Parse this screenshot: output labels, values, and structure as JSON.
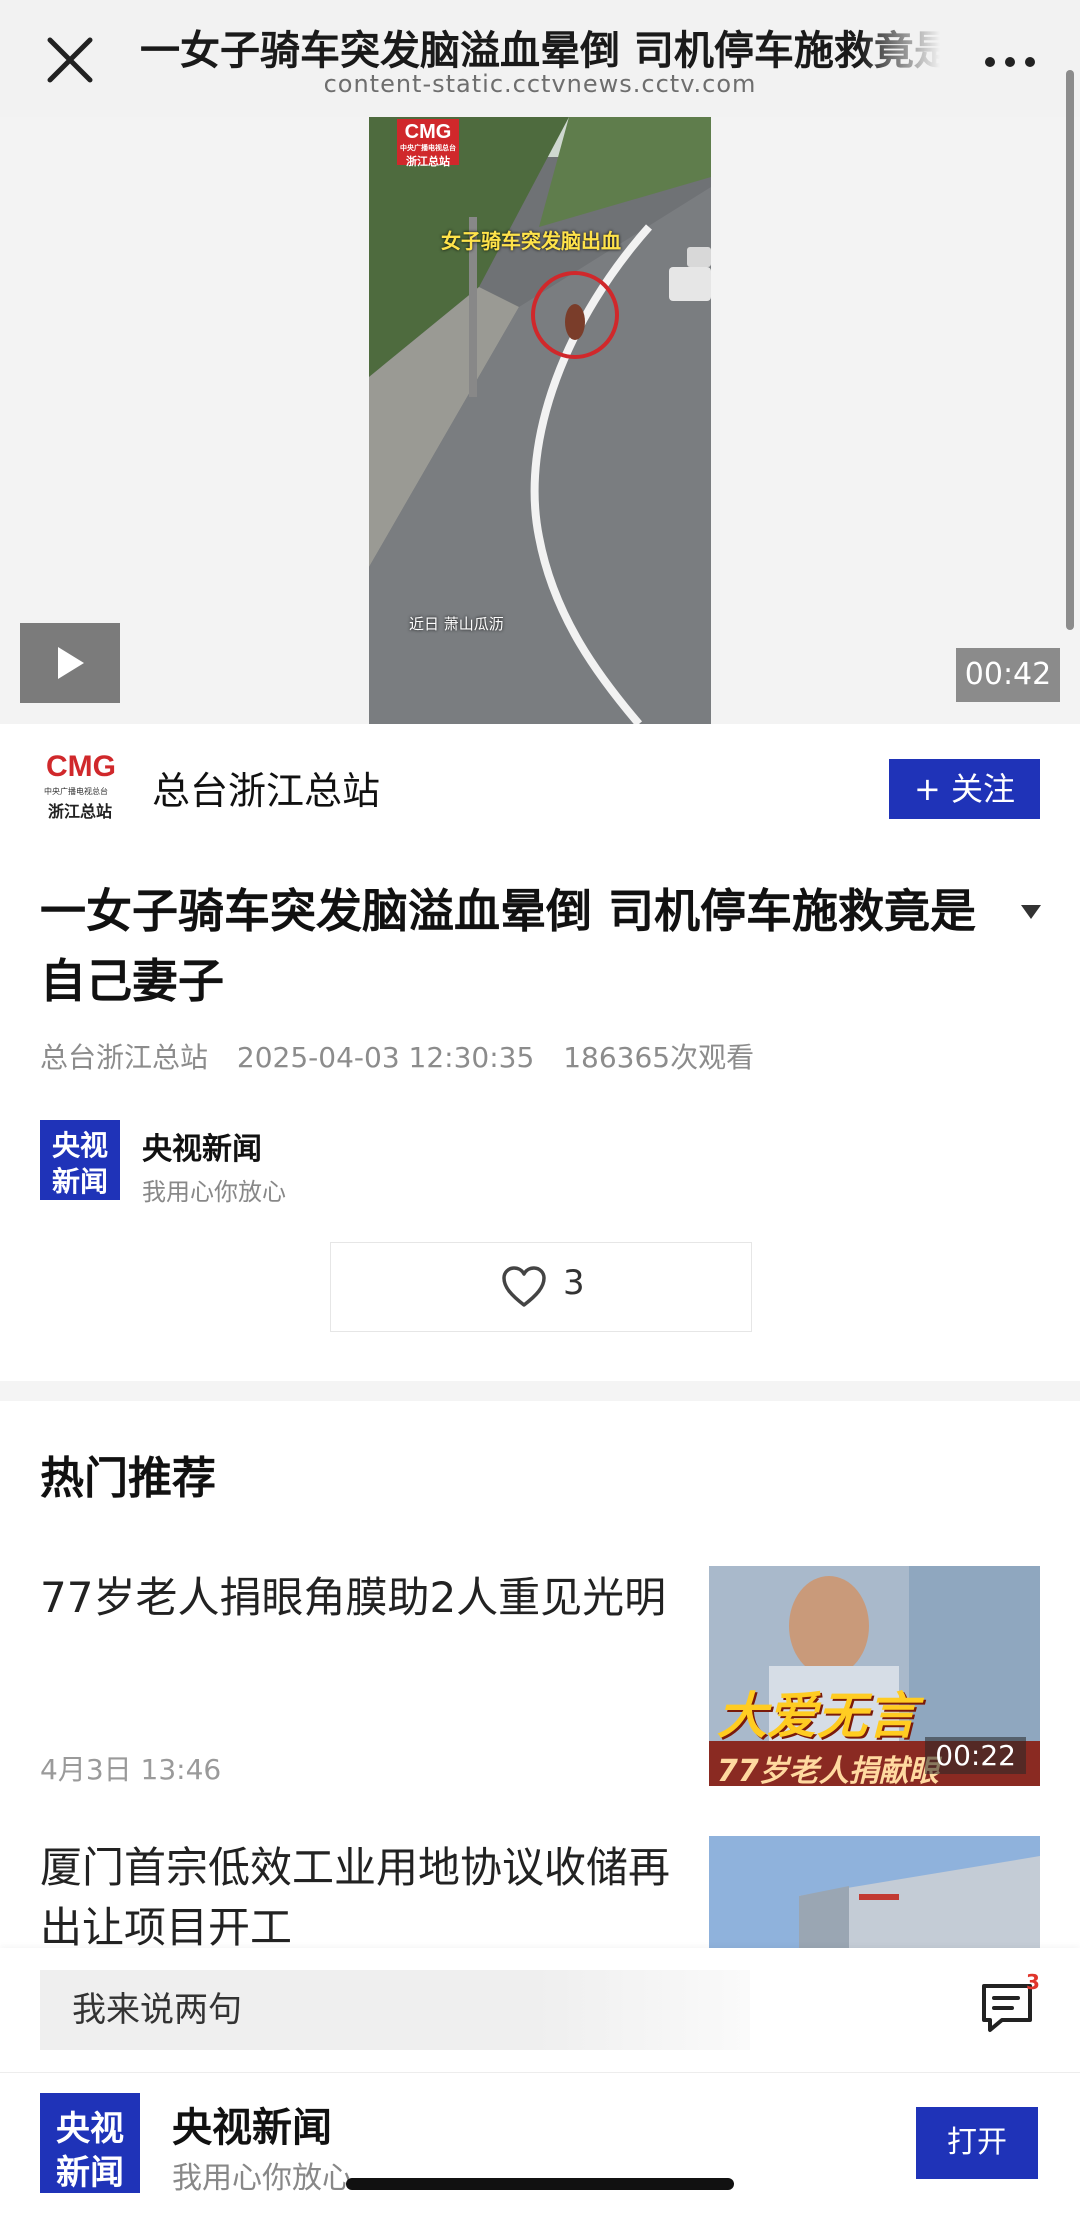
{
  "browser": {
    "page_title": "一女子骑车突发脑溢血晕倒 司机停车施救竟是自己妻子",
    "url": "content-static.cctvnews.cctv.com",
    "close_icon": "close-icon",
    "more_icon": "more-icon"
  },
  "video": {
    "overlay_logo": "CMG",
    "overlay_logo_sub": "中央广播电视总台",
    "overlay_logo_station": "浙江总站",
    "caption_top": "女子骑车突发脑出血",
    "caption_bottom": "近日  萧山瓜沥",
    "duration": "00:42",
    "play_icon": "play-icon"
  },
  "channel": {
    "logo_text": "CMG",
    "logo_sub": "中央广播电视总台",
    "logo_station": "浙江总站",
    "name": "总台浙江总站",
    "follow_label": "+ 关注"
  },
  "article": {
    "title": "一女子骑车突发脑溢血晕倒 司机停车施救竟是自己妻子",
    "source": "总台浙江总站",
    "datetime": "2025-04-03 12:30:35",
    "views": "186365次观看"
  },
  "source": {
    "logo_top": "央视",
    "logo_bottom": "新闻",
    "name": "央视新闻",
    "slogan": "我用心你放心"
  },
  "like": {
    "count": "3",
    "icon": "heart-icon"
  },
  "hot": {
    "section_title": "热门推荐",
    "items": [
      {
        "title": "77岁老人捐眼角膜助2人重见光明",
        "date": "4月3日 13:46",
        "thumb_caption": "大爱无言",
        "thumb_subcaption": "77岁老人捐献眼",
        "duration": "00:22"
      },
      {
        "title": "厦门首宗低效工业用地协议收储再出让项目开工"
      }
    ]
  },
  "comment": {
    "placeholder": "我来说两句",
    "count": "3",
    "icon": "comment-icon"
  },
  "app_banner": {
    "logo_top": "央视",
    "logo_bottom": "新闻",
    "name": "央视新闻",
    "slogan": "我用心你放心",
    "open_label": "打开"
  },
  "colors": {
    "brand_blue": "#1f33b8",
    "badge_red": "#e0352b"
  }
}
